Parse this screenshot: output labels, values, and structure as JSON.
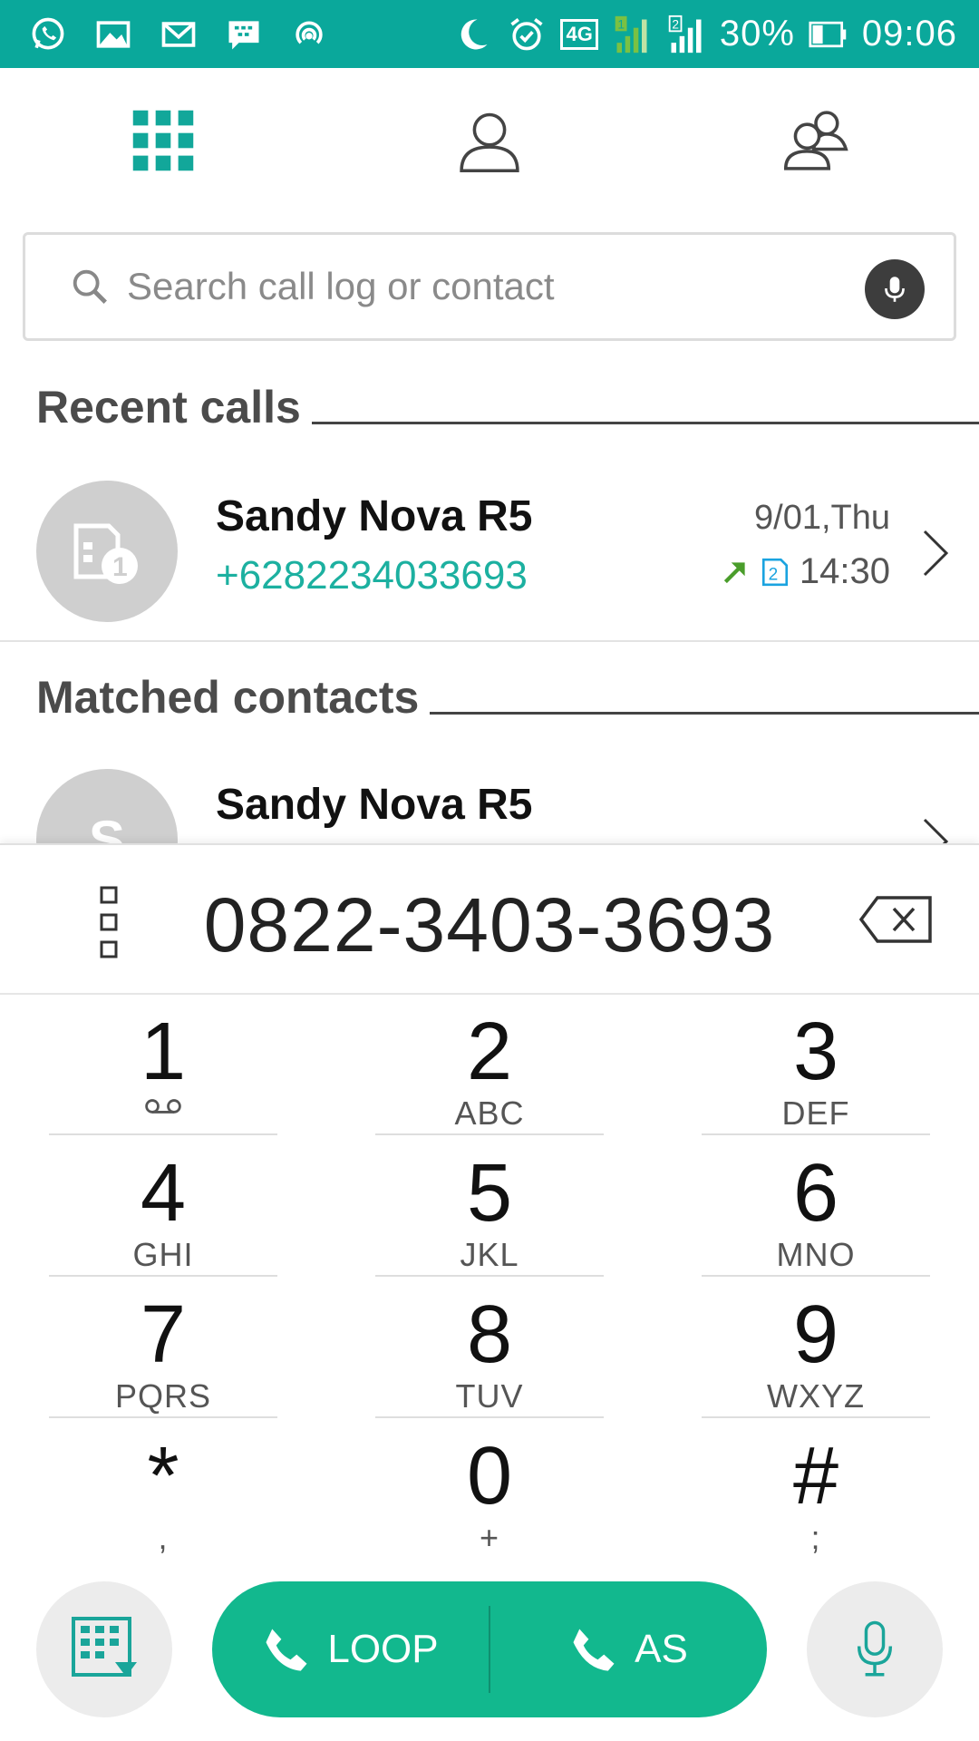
{
  "status_bar": {
    "battery": "30%",
    "time": "09:06",
    "network": "4G",
    "sim1_label": "1",
    "sim2_label": "2"
  },
  "search": {
    "placeholder": "Search call log or contact"
  },
  "recent_calls": {
    "header": "Recent calls",
    "items": [
      {
        "name": "Sandy Nova R5",
        "number": "+6282234033693",
        "date": "9/01,Thu",
        "time": "14:30",
        "sim": "2"
      }
    ]
  },
  "matched_contacts": {
    "header": "Matched contacts",
    "items": [
      {
        "name": "Sandy Nova R5",
        "initial": "S"
      }
    ]
  },
  "dialer": {
    "number": "0822-3403-3693",
    "keys": [
      {
        "digit": "1",
        "letters": ""
      },
      {
        "digit": "2",
        "letters": "ABC"
      },
      {
        "digit": "3",
        "letters": "DEF"
      },
      {
        "digit": "4",
        "letters": "GHI"
      },
      {
        "digit": "5",
        "letters": "JKL"
      },
      {
        "digit": "6",
        "letters": "MNO"
      },
      {
        "digit": "7",
        "letters": "PQRS"
      },
      {
        "digit": "8",
        "letters": "TUV"
      },
      {
        "digit": "9",
        "letters": "WXYZ"
      },
      {
        "digit": "*",
        "letters": ","
      },
      {
        "digit": "0",
        "letters": "+"
      },
      {
        "digit": "#",
        "letters": ";"
      }
    ]
  },
  "actions": {
    "call_sim1_label": "LOOP",
    "call_sim2_label": "AS"
  },
  "colors": {
    "accent": "#0aa89b",
    "call_button": "#12b88e",
    "number_text": "#1cb0a0",
    "outgoing_arrow": "#4a9d2b"
  }
}
